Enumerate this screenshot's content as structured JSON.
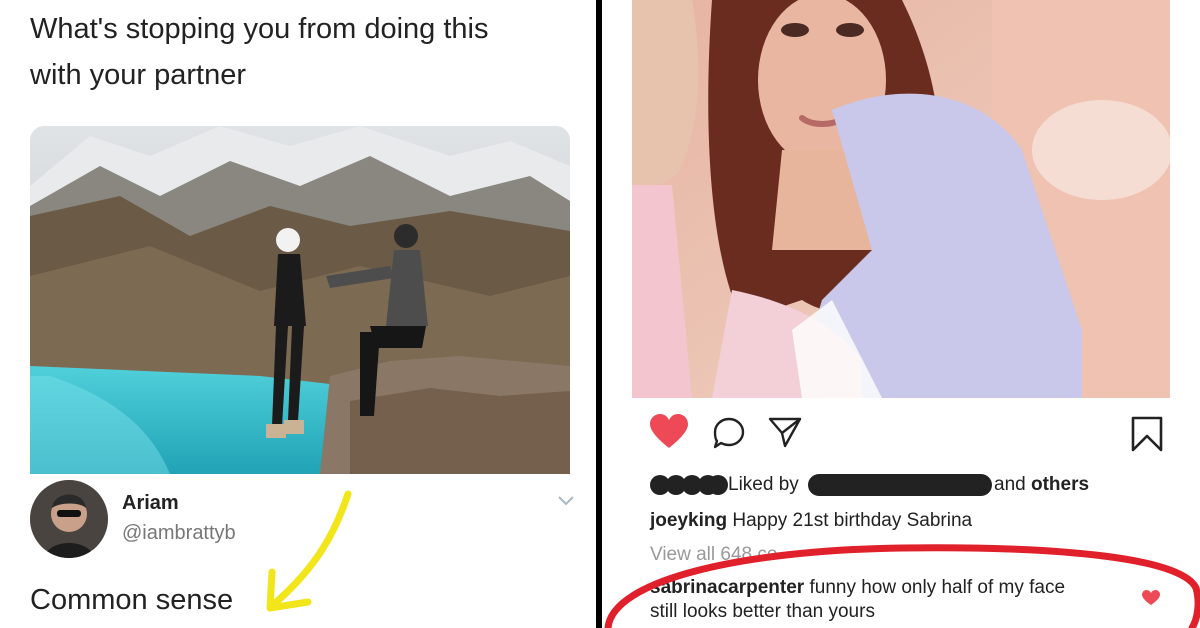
{
  "tweet": {
    "text_line1": "What's stopping you from doing this",
    "text_line2": "with your partner",
    "reply": {
      "name": "Ariam",
      "handle": "@iambrattyb",
      "text": "Common sense"
    },
    "icons": {
      "chevron": "chevron-down-icon",
      "arrow": "hand-drawn-arrow-icon"
    },
    "colors": {
      "arrow": "#f2e51a",
      "lake": "#3ec3d0"
    }
  },
  "instagram": {
    "liked_by_prefix": "Liked by",
    "liked_by_and": "and",
    "liked_by_others": "others",
    "caption": {
      "username": "joeyking",
      "text": "Happy 21st birthday Sabrina"
    },
    "view_all": "View all 648 co",
    "comment": {
      "username": "sabrinacarpenter",
      "text_line1": "funny how only half of my face",
      "text_line2": "still looks better than yours"
    },
    "icons": {
      "like": "heart-icon",
      "comment": "comment-bubble-icon",
      "share": "paper-plane-icon",
      "save": "bookmark-icon",
      "comment_like": "small-heart-icon"
    },
    "colors": {
      "heart": "#ed4956",
      "annotation_circle": "#e0202a"
    }
  }
}
